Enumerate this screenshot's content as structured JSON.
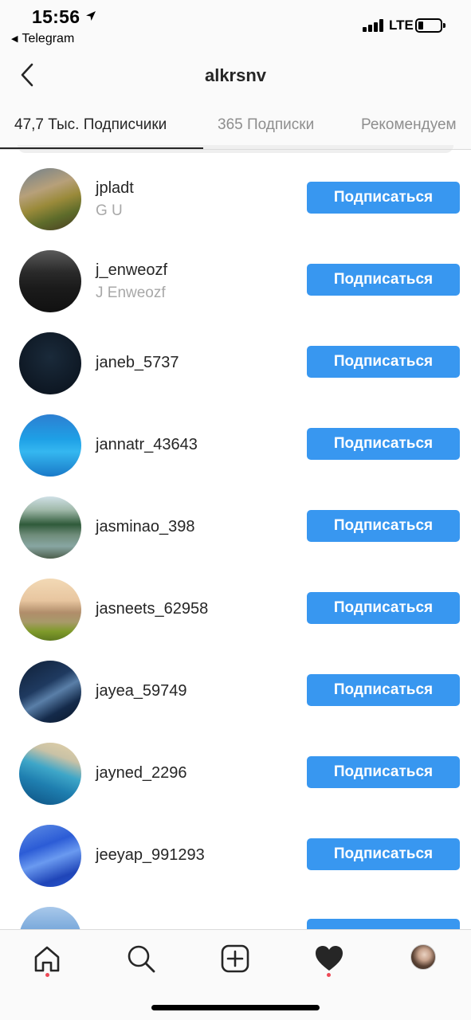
{
  "status_bar": {
    "time": "15:56",
    "back_app": "Telegram",
    "network": "LTE"
  },
  "header": {
    "title": "alkrsnv"
  },
  "tabs": [
    {
      "label": "47,7 Тыс. Подписчики",
      "active": true
    },
    {
      "label": "365 Подписки",
      "active": false
    },
    {
      "label": "Рекомендуем",
      "active": false
    }
  ],
  "follow_label": "Подписаться",
  "users": [
    {
      "username": "jpladt",
      "full_name": "G U"
    },
    {
      "username": "j_enweozf",
      "full_name": "J Enweozf"
    },
    {
      "username": "janeb_5737",
      "full_name": ""
    },
    {
      "username": "jannatr_43643",
      "full_name": ""
    },
    {
      "username": "jasminao_398",
      "full_name": ""
    },
    {
      "username": "jasneets_62958",
      "full_name": ""
    },
    {
      "username": "jayea_59749",
      "full_name": ""
    },
    {
      "username": "jayned_2296",
      "full_name": ""
    },
    {
      "username": "jeeyap_991293",
      "full_name": ""
    }
  ],
  "tab_bar": {
    "items": [
      "home-icon",
      "search-icon",
      "new-post-icon",
      "activity-heart-icon",
      "profile-avatar"
    ],
    "notification_dots": [
      "home",
      "activity"
    ]
  },
  "colors": {
    "accent": "#3897f0",
    "notification": "#ed4956",
    "text_primary": "#262626",
    "text_secondary": "#a8a8a8"
  }
}
